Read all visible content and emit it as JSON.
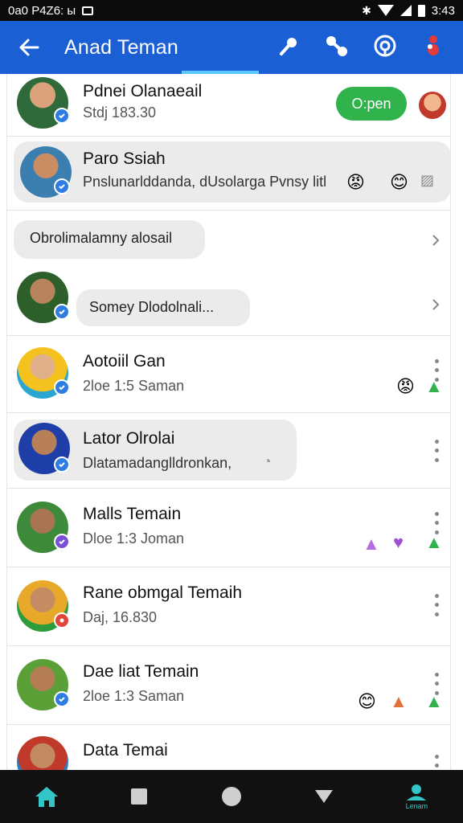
{
  "status_bar": {
    "left_text": "0a0 P4Z6: ы",
    "time": "3:43"
  },
  "app_bar": {
    "title": "Anad Teman"
  },
  "rows": [
    {
      "name": "Pdnei Olanaeail",
      "subtitle": "Stdj 183.30",
      "action_label": "O:pen"
    },
    {
      "name": "Paro Ssiah",
      "preview": "Pnslunarlddanda, dUsolarga Pvnsy litl"
    },
    {
      "preview": "Obrolimalamny alosail"
    },
    {
      "preview": "Somey Dlodolnali..."
    },
    {
      "name": "Aotoiil Gan",
      "subtitle": "2loe 1:5 Saman"
    },
    {
      "name": "Lator Olrolai",
      "preview": "Dlatamadanglldronkan,"
    },
    {
      "name": "Malls Temain",
      "subtitle": "Dloe 1:3 Joman"
    },
    {
      "name": "Rane obmgal Temaih",
      "subtitle": "Daj, 16.830"
    },
    {
      "name": "Dae liat Temain",
      "subtitle": "2loe 1:3 Saman"
    },
    {
      "name": "Data Temai"
    }
  ],
  "nav": {
    "contacts_label": "Lenam"
  },
  "colors": {
    "app_bar": "#1a5fd3",
    "accent_tab": "#5bc8ff",
    "online_badge": "#2f7de1",
    "action_green": "#2fb34a"
  },
  "icons": [
    "back-arrow-icon",
    "pin-icon",
    "call-icon",
    "settings-icon",
    "more-icon",
    "chevron-right-icon",
    "kebab-menu-icon",
    "home-icon",
    "square-icon",
    "circle-icon",
    "triangle-icon",
    "contacts-icon"
  ]
}
